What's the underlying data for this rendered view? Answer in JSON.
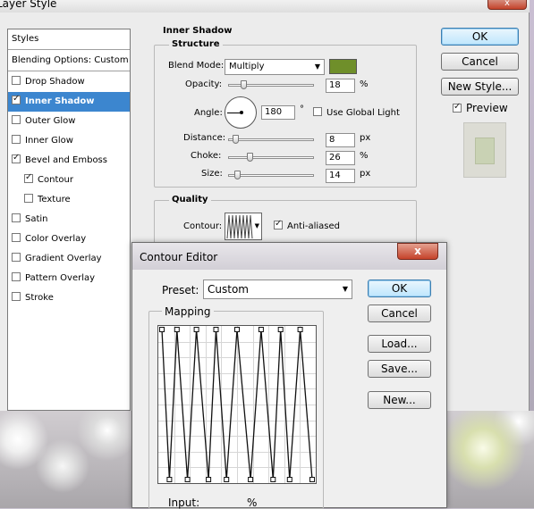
{
  "layer_style": {
    "title": "Layer Style",
    "close_label": "x",
    "styles_header": "Styles",
    "blending_options": "Blending Options: Custom",
    "effects": [
      {
        "label": "Drop Shadow",
        "checked": false,
        "selected": false
      },
      {
        "label": "Inner Shadow",
        "checked": true,
        "selected": true
      },
      {
        "label": "Outer Glow",
        "checked": false,
        "selected": false
      },
      {
        "label": "Inner Glow",
        "checked": false,
        "selected": false
      },
      {
        "label": "Bevel and Emboss",
        "checked": true,
        "selected": false
      },
      {
        "label": "Contour",
        "checked": true,
        "selected": false
      },
      {
        "label": "Texture",
        "checked": false,
        "selected": false
      },
      {
        "label": "Satin",
        "checked": false,
        "selected": false
      },
      {
        "label": "Color Overlay",
        "checked": false,
        "selected": false
      },
      {
        "label": "Gradient Overlay",
        "checked": false,
        "selected": false
      },
      {
        "label": "Pattern Overlay",
        "checked": false,
        "selected": false
      },
      {
        "label": "Stroke",
        "checked": false,
        "selected": false
      }
    ],
    "panel_title": "Inner Shadow",
    "structure": {
      "title": "Structure",
      "blend_mode_label": "Blend Mode:",
      "blend_mode_value": "Multiply",
      "blend_color": "#6f8f2a",
      "opacity_label": "Opacity:",
      "opacity_value": "18",
      "opacity_level": 0.18,
      "opacity_unit": "%",
      "angle_label": "Angle:",
      "angle_value": "180",
      "angle_unit": "°",
      "global_light_label": "Use Global Light",
      "global_light_checked": false,
      "distance_label": "Distance:",
      "distance_value": "8",
      "distance_unit": "px",
      "choke_label": "Choke:",
      "choke_value": "26",
      "choke_unit": "%",
      "size_label": "Size:",
      "size_value": "14",
      "size_unit": "px"
    },
    "quality": {
      "title": "Quality",
      "contour_label": "Contour:",
      "anti_aliased_label": "Anti-aliased",
      "anti_aliased_checked": true
    },
    "buttons": {
      "ok": "OK",
      "cancel": "Cancel",
      "new_style": "New Style...",
      "preview": "Preview",
      "preview_checked": true
    }
  },
  "contour_editor": {
    "title": "Contour Editor",
    "close_label": "x",
    "preset_label": "Preset:",
    "preset_value": "Custom",
    "mapping_title": "Mapping",
    "input_label": "Input:",
    "input_unit": "%",
    "buttons": {
      "ok": "OK",
      "cancel": "Cancel",
      "load": "Load...",
      "save": "Save...",
      "new": "New..."
    },
    "curve_points": [
      [
        0,
        100
      ],
      [
        0.05,
        0
      ],
      [
        0.1,
        100
      ],
      [
        0.17,
        0
      ],
      [
        0.23,
        100
      ],
      [
        0.31,
        0
      ],
      [
        0.36,
        100
      ],
      [
        0.43,
        0
      ],
      [
        0.5,
        100
      ],
      [
        0.59,
        0
      ],
      [
        0.66,
        100
      ],
      [
        0.74,
        0
      ],
      [
        0.79,
        100
      ],
      [
        0.85,
        0
      ],
      [
        0.92,
        100
      ],
      [
        1,
        0
      ]
    ]
  }
}
